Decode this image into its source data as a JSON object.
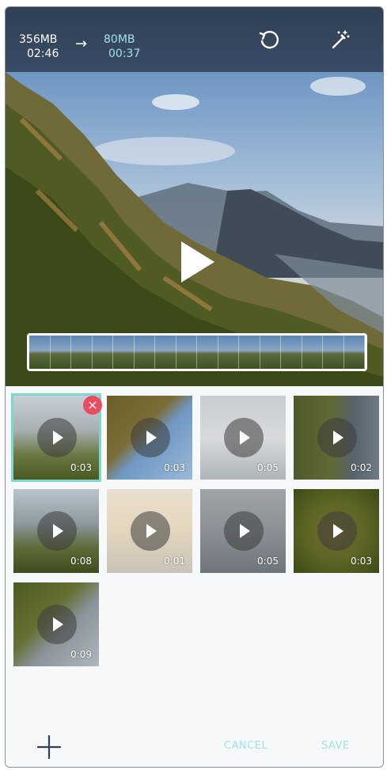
{
  "header": {
    "original_size": "356MB",
    "original_time": "02:46",
    "arrow": "→",
    "new_size": "80MB",
    "new_time": "00:37",
    "reset_icon": "rotate-ccw-icon",
    "auto_edit_icon": "magic-wand-icon"
  },
  "preview": {
    "play_icon": "play-icon"
  },
  "clips": [
    {
      "duration": "0:03",
      "selected": true
    },
    {
      "duration": "0:03",
      "selected": false
    },
    {
      "duration": "0:05",
      "selected": false
    },
    {
      "duration": "0:02",
      "selected": false
    },
    {
      "duration": "0:08",
      "selected": false
    },
    {
      "duration": "0:01",
      "selected": false
    },
    {
      "duration": "0:05",
      "selected": false
    },
    {
      "duration": "0:03",
      "selected": false
    },
    {
      "duration": "0:09",
      "selected": false
    }
  ],
  "delete_icon": "close-icon",
  "footer": {
    "add_icon": "plus-icon",
    "cancel_label": "CANCEL",
    "save_label": "SAVE"
  },
  "colors": {
    "accent": "#9fe3e2",
    "delete": "#e94b63",
    "selected_outline": "#7dd8cc"
  }
}
